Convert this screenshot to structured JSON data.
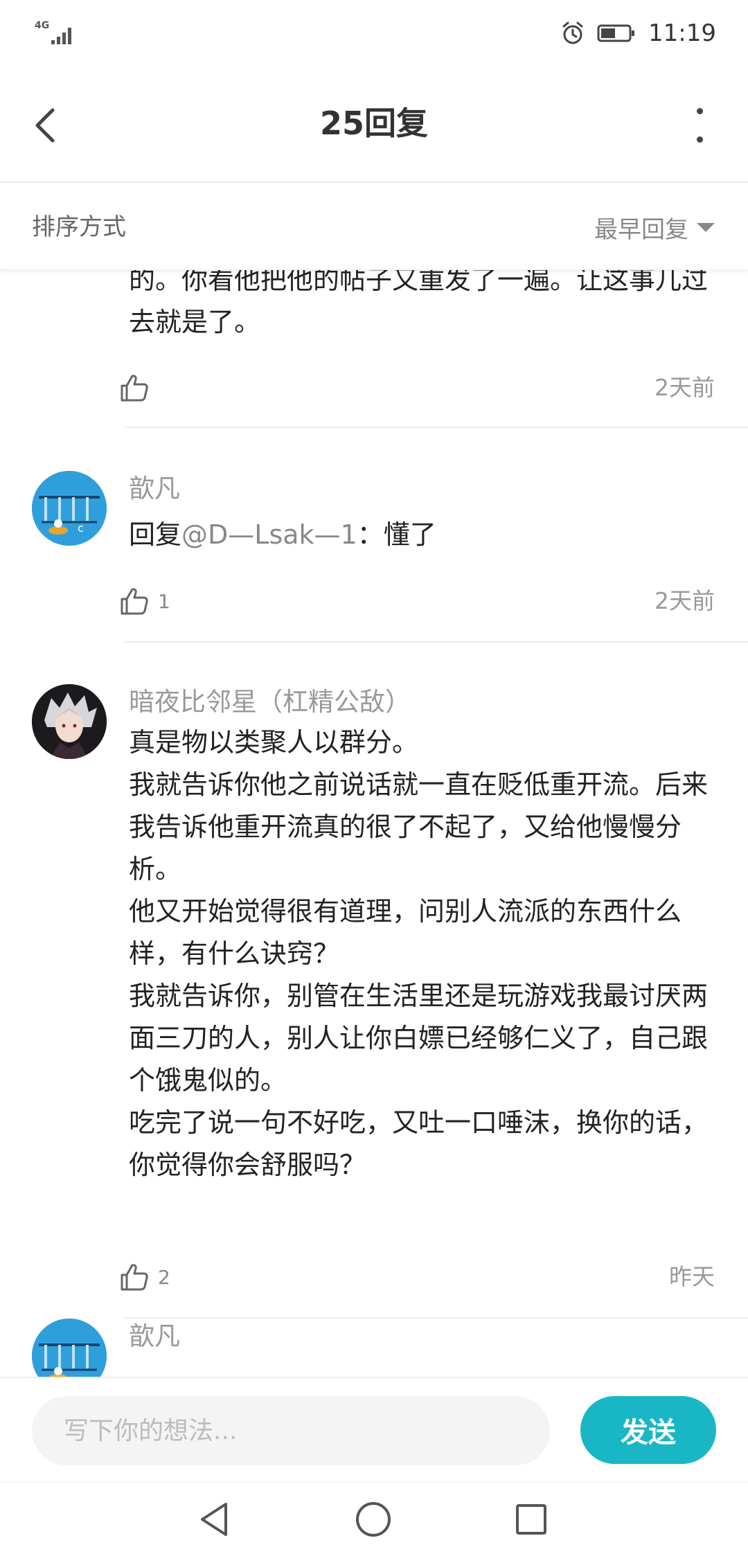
{
  "status_bar": {
    "network": "4G",
    "time": "11:19"
  },
  "header": {
    "title": "25回复"
  },
  "sort": {
    "label": "排序方式",
    "value": "最早回复"
  },
  "comments": [
    {
      "username": "",
      "content": "的。你看他把他的帖子又重发了一遍。让这事儿过去就是了。",
      "likes": "",
      "time": "2天前"
    },
    {
      "username": "歆凡",
      "reply_prefix": "回复",
      "mention": "@D—Lsak—1",
      "reply_text": "：懂了",
      "likes": "1",
      "time": "2天前"
    },
    {
      "username": "暗夜比邻星（杠精公敌）",
      "content": "真是物以类聚人以群分。\n我就告诉你他之前说话就一直在贬低重开流。后来我告诉他重开流真的很了不起了，又给他慢慢分析。\n他又开始觉得很有道理，问别人流派的东西什么样，有什么诀窍？\n我就告诉你，别管在生活里还是玩游戏我最讨厌两面三刀的人，别人让你白嫖已经够仁义了，自己跟个饿鬼似的。\n吃完了说一句不好吃，又吐一口唾沫，换你的话，你觉得你会舒服吗？",
      "likes": "2",
      "time": "昨天"
    },
    {
      "username": "歆凡"
    }
  ],
  "input": {
    "placeholder": "写下你的想法...",
    "send_label": "发送"
  },
  "colors": {
    "accent": "#19b7c6",
    "avatar_blue": "#2f9fdc"
  },
  "icons": {
    "back": "chevron-left-icon",
    "more": "more-vertical-icon",
    "like": "thumbs-up-icon",
    "alarm": "alarm-icon",
    "battery": "battery-icon"
  }
}
